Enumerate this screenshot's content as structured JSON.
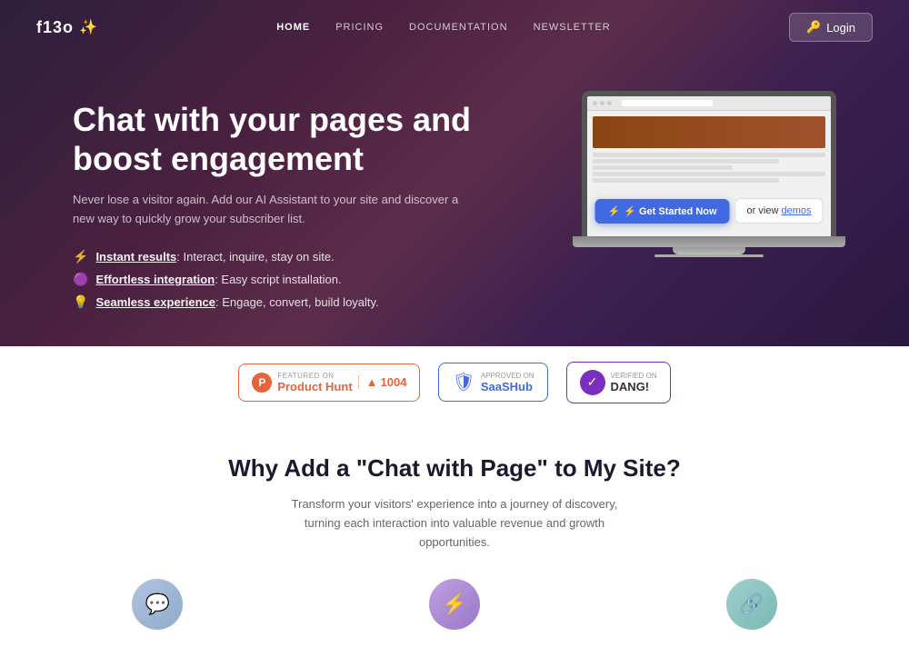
{
  "brand": {
    "name": "f13o",
    "sparkle": "✨"
  },
  "nav": {
    "links": [
      {
        "label": "HOME",
        "href": "#",
        "active": true
      },
      {
        "label": "PRICING",
        "href": "#",
        "active": false
      },
      {
        "label": "DOCUMENTATION",
        "href": "#",
        "active": false
      },
      {
        "label": "NEWSLETTER",
        "href": "#",
        "active": false
      }
    ],
    "login_icon": "🔑",
    "login_label": "Login"
  },
  "hero": {
    "title": "Chat with your pages and boost engagement",
    "subtitle": "Never lose a visitor again. Add our AI Assistant to your site and discover a new way to quickly grow your subscriber list.",
    "features": [
      {
        "icon": "⚡",
        "bold": "Instant results",
        "text": ": Interact, inquire, stay on site."
      },
      {
        "icon": "🟣",
        "bold": "Effortless integration",
        "text": ": Easy script installation."
      },
      {
        "icon": "💡",
        "bold": "Seamless experience",
        "text": ": Engage, convert, build loyalty."
      }
    ],
    "cta_primary": "⚡ Get Started Now",
    "cta_secondary_text": "or view ",
    "cta_secondary_link": "demos"
  },
  "badges": [
    {
      "type": "producthunt",
      "featured_label": "FEATURED ON",
      "name": "Product Hunt",
      "count_icon": "▲",
      "count": "1004"
    },
    {
      "type": "saashub",
      "approved_label": "Approved on",
      "name": "SaaSHub"
    },
    {
      "type": "dang",
      "verified_label": "Verified on",
      "name": "DANG!"
    }
  ],
  "lower": {
    "title": "Why Add a \"Chat with Page\" to My Site?",
    "subtitle": "Transform your visitors' experience into a journey of discovery, turning each interaction into valuable revenue and growth opportunities."
  },
  "icons": {
    "chat_icon": "💬",
    "bolt_icon": "⚡",
    "shield_icon": "🛡",
    "check_icon": "✓",
    "triangle_icon": "▲"
  }
}
